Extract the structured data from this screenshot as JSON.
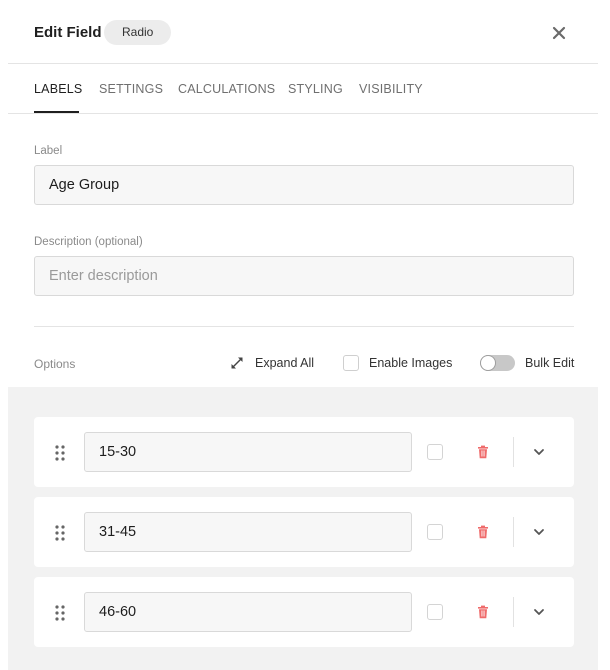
{
  "header": {
    "title": "Edit Field",
    "field_type": "Radio",
    "close_icon": "close-icon"
  },
  "tabs": [
    {
      "label": "LABELS",
      "active": true
    },
    {
      "label": "SETTINGS",
      "active": false
    },
    {
      "label": "CALCULATIONS",
      "active": false
    },
    {
      "label": "STYLING",
      "active": false
    },
    {
      "label": "VISIBILITY",
      "active": false
    }
  ],
  "form": {
    "label_field": {
      "label": "Label",
      "value": "Age Group"
    },
    "description_field": {
      "label": "Description (optional)",
      "value": "",
      "placeholder": "Enter description"
    }
  },
  "options": {
    "title": "Options",
    "expand_all_label": "Expand All",
    "enable_images_label": "Enable Images",
    "enable_images_checked": false,
    "bulk_edit_label": "Bulk Edit",
    "bulk_edit_on": false,
    "items": [
      {
        "value": "15-30",
        "checked": false
      },
      {
        "value": "31-45",
        "checked": false
      },
      {
        "value": "46-60",
        "checked": false
      }
    ]
  },
  "colors": {
    "delete_icon": "#ef6b6b",
    "active_tab": "#1f1f1f",
    "options_background": "#f2f2f2"
  }
}
